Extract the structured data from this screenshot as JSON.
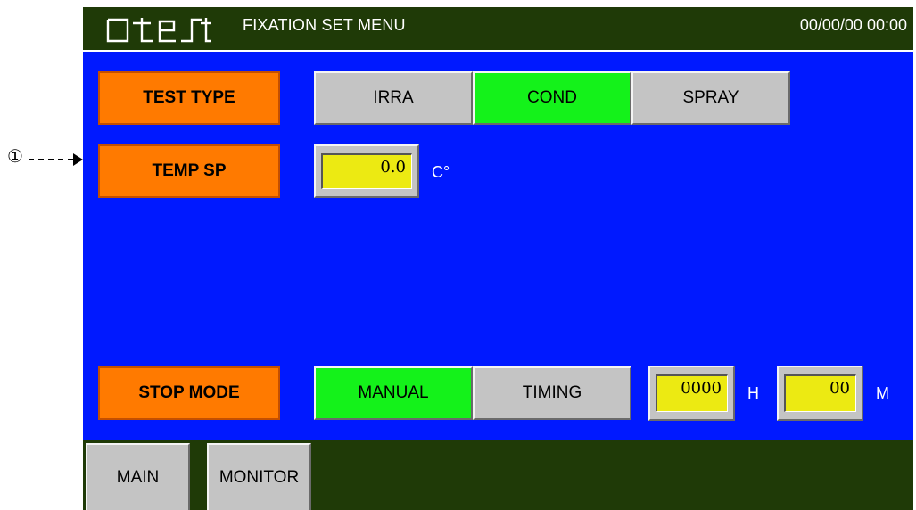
{
  "annotation": {
    "number": "①"
  },
  "header": {
    "logo_text": "qtest",
    "title": "FIXATION SET MENU",
    "datetime": "00/00/00 00:00"
  },
  "test_type": {
    "label": "TEST TYPE",
    "options": [
      {
        "label": "IRRA",
        "selected": false
      },
      {
        "label": "COND",
        "selected": true
      },
      {
        "label": "SPRAY",
        "selected": false
      }
    ]
  },
  "temp_sp": {
    "label": "TEMP SP",
    "value": "0.0",
    "unit": "C°"
  },
  "stop_mode": {
    "label": "STOP MODE",
    "options": [
      {
        "label": "MANUAL",
        "selected": true
      },
      {
        "label": "TIMING",
        "selected": false
      }
    ],
    "hours": {
      "value": "0000",
      "unit": "H"
    },
    "minutes": {
      "value": "00",
      "unit": "M"
    }
  },
  "footer": {
    "tabs": [
      {
        "label": "MAIN"
      },
      {
        "label": "MONITOR"
      }
    ]
  },
  "colors": {
    "header_bg": "#1f3a07",
    "panel_bg": "#0019ff",
    "label_orange": "#ff7a00",
    "selected_green": "#14f21a",
    "button_gray": "#c4c4c4",
    "field_yellow": "#ecea12"
  }
}
